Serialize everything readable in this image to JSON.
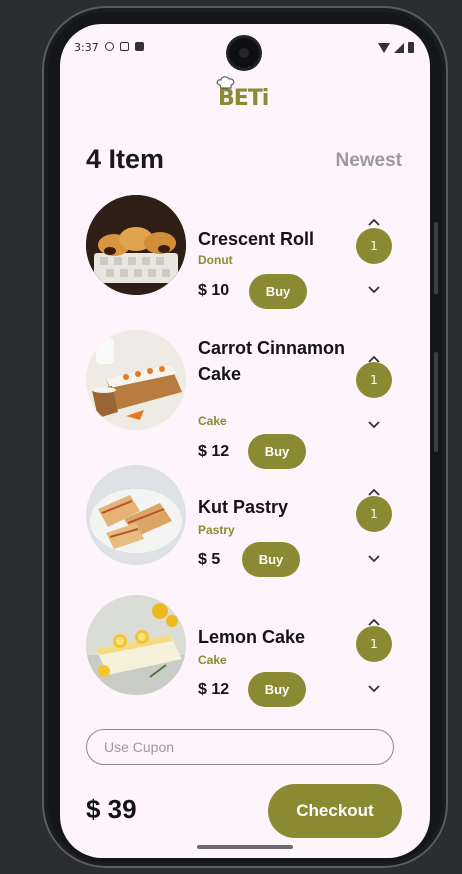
{
  "status": {
    "time": "3:37"
  },
  "logo": {
    "text": "BETi"
  },
  "header": {
    "count_label": "4 Item",
    "sort_label": "Newest"
  },
  "products": [
    {
      "name": "Crescent Roll",
      "category": "Donut",
      "price": "$ 10",
      "buy_label": "Buy",
      "quantity": "1"
    },
    {
      "name": "Carrot Cinnamon Cake",
      "category": "Cake",
      "price": "$ 12",
      "buy_label": "Buy",
      "quantity": "1"
    },
    {
      "name": "Kut Pastry",
      "category": "Pastry",
      "price": "$ 5",
      "buy_label": "Buy",
      "quantity": "1"
    },
    {
      "name": "Lemon Cake",
      "category": "Cake",
      "price": "$ 12",
      "buy_label": "Buy",
      "quantity": "1"
    }
  ],
  "coupon": {
    "placeholder": "Use Cupon",
    "value": ""
  },
  "footer": {
    "total": "$ 39",
    "checkout_label": "Checkout"
  },
  "colors": {
    "accent": "#8b8a33",
    "background": "#fdf5fb"
  }
}
